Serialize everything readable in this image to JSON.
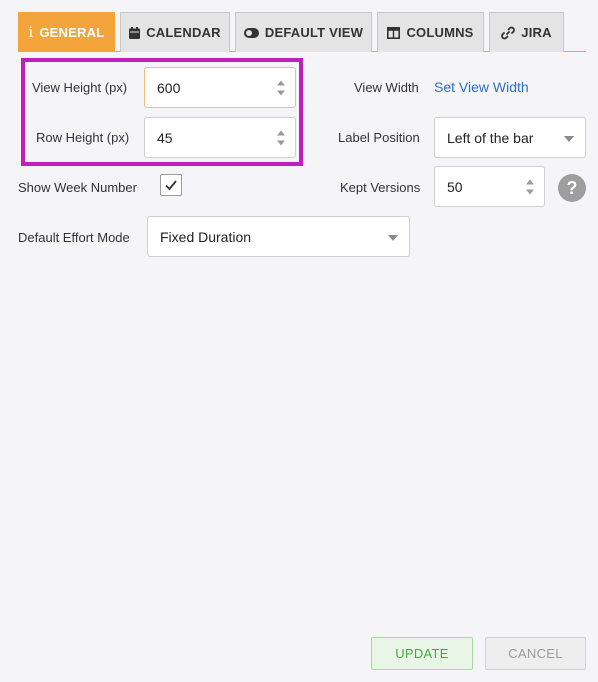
{
  "tabs": [
    {
      "label": "GENERAL",
      "icon": "info-icon",
      "active": true
    },
    {
      "label": "CALENDAR",
      "icon": "calendar-icon"
    },
    {
      "label": "DEFAULT VIEW",
      "icon": "toggle-icon"
    },
    {
      "label": "COLUMNS",
      "icon": "columns-icon"
    },
    {
      "label": "JIRA",
      "icon": "link-icon"
    }
  ],
  "form": {
    "view_height": {
      "label": "View Height (px)",
      "value": "600"
    },
    "row_height": {
      "label": "Row Height (px)",
      "value": "45"
    },
    "show_week_number": {
      "label": "Show Week Number",
      "checked": true
    },
    "default_effort_mode": {
      "label": "Default Effort Mode",
      "value": "Fixed Duration"
    },
    "view_width": {
      "label": "View Width",
      "link": "Set View Width"
    },
    "label_position": {
      "label": "Label Position",
      "value": "Left of the bar"
    },
    "kept_versions": {
      "label": "Kept Versions",
      "value": "50"
    },
    "help": "?"
  },
  "buttons": {
    "update": "UPDATE",
    "cancel": "CANCEL"
  },
  "colors": {
    "accent": "#f3a53c",
    "highlight": "#c01fbd",
    "link": "#2a6fc9",
    "update": "#49a544"
  }
}
